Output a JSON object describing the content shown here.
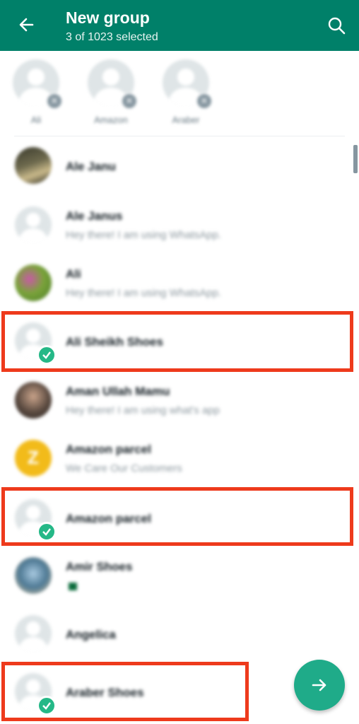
{
  "header": {
    "title": "New group",
    "subtitle": "3 of 1023 selected"
  },
  "selected": [
    {
      "label": "Ali"
    },
    {
      "label": "Amazon"
    },
    {
      "label": "Araber"
    }
  ],
  "contacts": [
    {
      "name": "Ale Janu",
      "status": "",
      "avatar": "photo",
      "selected": false
    },
    {
      "name": "Ale Janus",
      "status": "Hey there! I am using WhatsApp.",
      "avatar": "default",
      "selected": false
    },
    {
      "name": "Ali",
      "status": "Hey there! I am using WhatsApp.",
      "avatar": "photo",
      "selected": false
    },
    {
      "name": "Ali Sheikh Shoes",
      "status": "",
      "avatar": "default",
      "selected": true
    },
    {
      "name": "Aman Ullah Mamu",
      "status": "Hey there! I am using what's app",
      "avatar": "photo",
      "selected": false
    },
    {
      "name": "Amazon parcel",
      "status": "We Care Our Customers",
      "avatar": "letter",
      "letter": "Z",
      "selected": false
    },
    {
      "name": "Amazon parcel",
      "status": "",
      "avatar": "default",
      "selected": true
    },
    {
      "name": "Amir Shoes",
      "status": "",
      "avatar": "photo",
      "selected": false
    },
    {
      "name": "Angelica",
      "status": "",
      "avatar": "default",
      "selected": false
    },
    {
      "name": "Araber Shoes",
      "status": "",
      "avatar": "default",
      "selected": true
    }
  ],
  "colors": {
    "appbar": "#008069",
    "fab": "#1fab89",
    "check": "#25b887",
    "highlight": "#ee3a1c"
  },
  "icons": {
    "back": "arrow-left-icon",
    "search": "search-icon",
    "fab": "arrow-right-icon",
    "check": "check-icon",
    "remove": "close-icon"
  }
}
